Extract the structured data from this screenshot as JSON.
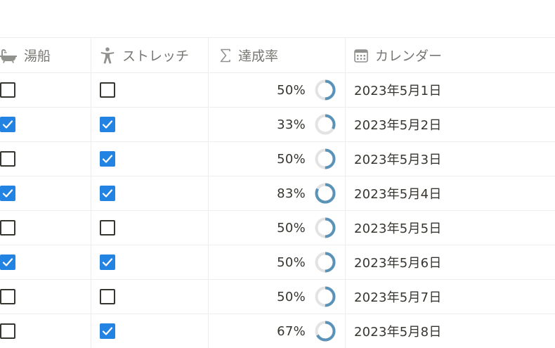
{
  "columns": {
    "bath": {
      "label": "湯船",
      "icon": "bathtub-icon"
    },
    "stretch": {
      "label": "ストレッチ",
      "icon": "person-icon"
    },
    "rate": {
      "label": "達成率",
      "icon": "sigma-icon"
    },
    "date": {
      "label": "カレンダー",
      "icon": "calendar-icon"
    }
  },
  "colors": {
    "checked": "#2383e2",
    "ring_progress": "#5b93b8",
    "ring_track": "#e3e3e3",
    "header_text": "#787774",
    "text": "#37352f",
    "divider": "#ededec"
  },
  "rows": [
    {
      "bath": false,
      "stretch": false,
      "rate": "50%",
      "progress": 0.5,
      "date": "2023年5月1日"
    },
    {
      "bath": true,
      "stretch": true,
      "rate": "33%",
      "progress": 0.33,
      "date": "2023年5月2日"
    },
    {
      "bath": false,
      "stretch": true,
      "rate": "50%",
      "progress": 0.5,
      "date": "2023年5月3日"
    },
    {
      "bath": true,
      "stretch": true,
      "rate": "83%",
      "progress": 0.83,
      "date": "2023年5月4日"
    },
    {
      "bath": false,
      "stretch": false,
      "rate": "50%",
      "progress": 0.5,
      "date": "2023年5月5日"
    },
    {
      "bath": true,
      "stretch": true,
      "rate": "50%",
      "progress": 0.5,
      "date": "2023年5月6日"
    },
    {
      "bath": false,
      "stretch": false,
      "rate": "50%",
      "progress": 0.5,
      "date": "2023年5月7日"
    },
    {
      "bath": false,
      "stretch": true,
      "rate": "67%",
      "progress": 0.67,
      "date": "2023年5月8日"
    }
  ]
}
